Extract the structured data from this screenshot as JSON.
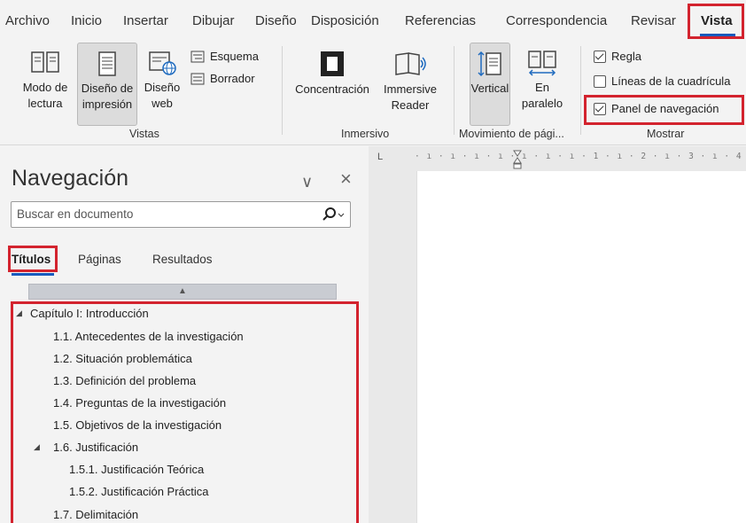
{
  "menu": {
    "tabs": [
      "Archivo",
      "Inicio",
      "Insertar",
      "Dibujar",
      "Diseño",
      "Disposición",
      "Referencias",
      "Correspondencia",
      "Revisar",
      "Vista"
    ],
    "active": "Vista"
  },
  "ribbon": {
    "vistas": {
      "modo_lectura": "Modo de lectura",
      "diseno_impresion": "Diseño de impresión",
      "diseno_web": "Diseño web",
      "esquema": "Esquema",
      "borrador": "Borrador",
      "group_label": "Vistas"
    },
    "inmersivo": {
      "concentracion": "Concentración",
      "immersive_reader": "Immersive Reader",
      "group_label": "Inmersivo"
    },
    "movimiento": {
      "vertical": "Vertical",
      "en_paralelo": "En paralelo",
      "group_label": "Movimiento de pági..."
    },
    "mostrar": {
      "regla": "Regla",
      "lineas": "Líneas de la cuadrícula",
      "panel": "Panel de navegación",
      "group_label": "Mostrar"
    }
  },
  "nav": {
    "title": "Navegación",
    "search_placeholder": "Buscar en documento",
    "tabs": [
      "Títulos",
      "Páginas",
      "Resultados"
    ],
    "headings": [
      "Capítulo I: Introducción",
      "1.1.  Antecedentes de la investigación",
      "1.2. Situación problemática",
      "1.3.  Definición del problema",
      "1.4.  Preguntas de la investigación",
      "1.5. Objetivos de la investigación",
      "1.6. Justificación",
      "1.5.1. Justificación Teórica",
      "1.5.2. Justificación Práctica",
      "1.7. Delimitación"
    ]
  },
  "ruler": {
    "corner": "L",
    "marks": "· ı · ı · ı · ı · ı · ı · ı · 1 · ı · 2 · ı · 3 · ı · 4 · ı · 5 · ı"
  },
  "colors": {
    "accent": "#185abd",
    "highlight": "#d3232e"
  }
}
